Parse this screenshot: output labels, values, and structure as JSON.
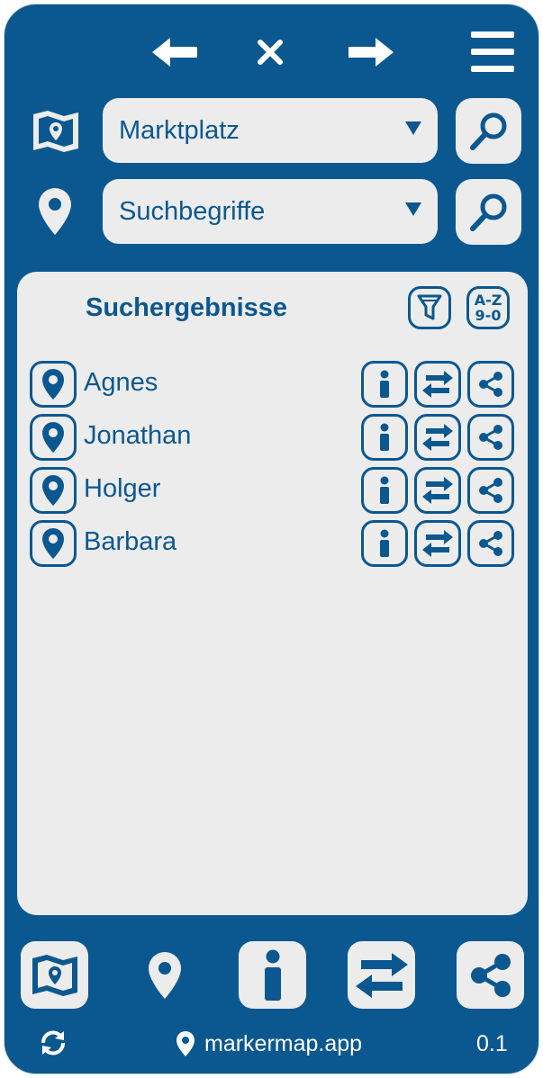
{
  "header": {
    "back_icon": "arrow-left-icon",
    "close_icon": "close-icon",
    "forward_icon": "arrow-right-icon",
    "menu_icon": "hamburger-menu-icon"
  },
  "map_select": {
    "value": "Marktplatz",
    "icon": "map-icon"
  },
  "term_select": {
    "value": "Suchbegriffe",
    "icon": "map-pin-icon"
  },
  "results": {
    "title": "Suchergebnisse",
    "sort_label_top": "A-Z",
    "sort_label_bottom": "9-0",
    "items": [
      {
        "name": "Agnes"
      },
      {
        "name": "Jonathan"
      },
      {
        "name": "Holger"
      },
      {
        "name": "Barbara"
      }
    ]
  },
  "footer": {
    "site": "markermap.app",
    "version": "0.1"
  },
  "colors": {
    "primary": "#0b5890",
    "surface": "#ececec",
    "white": "#ffffff"
  }
}
